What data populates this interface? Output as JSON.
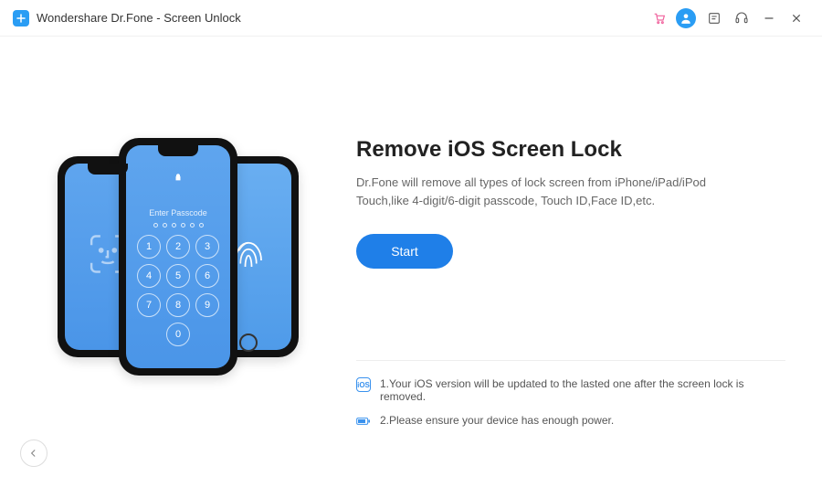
{
  "titlebar": {
    "title": "Wondershare Dr.Fone - Screen Unlock"
  },
  "illustration": {
    "passcode_label": "Enter Passcode",
    "keypad": [
      "1",
      "2",
      "3",
      "4",
      "5",
      "6",
      "7",
      "8",
      "9",
      "0"
    ]
  },
  "main": {
    "heading": "Remove iOS Screen Lock",
    "description": "Dr.Fone will remove all types of lock screen from iPhone/iPad/iPod Touch,like 4-digit/6-digit passcode, Touch ID,Face ID,etc.",
    "start_button": "Start"
  },
  "notes": {
    "note1": "1.Your iOS version will be updated to the lasted one after the screen lock is removed.",
    "note2": "2.Please ensure your device has enough power.",
    "ios_badge": "iOS"
  }
}
